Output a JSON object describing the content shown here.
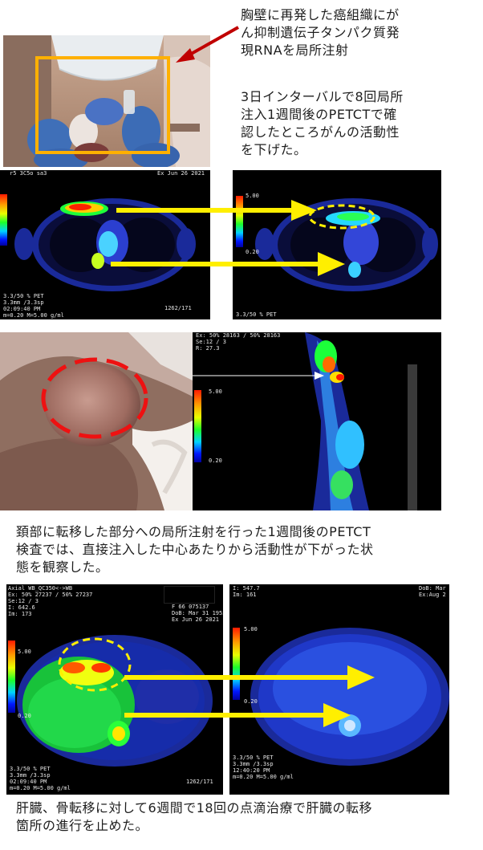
{
  "top_note": {
    "line1": "胸壁に再発した癌組織にが",
    "line2": "ん抑制遺伝子タンパク質発",
    "line3": "現RNAを局所注射"
  },
  "interval_note": {
    "line1": "3日インターバルで8回局所",
    "line2": "注入1週間後のPETCTで確",
    "line3": "認したところがんの活動性",
    "line4": "を下げた。"
  },
  "neck_note": {
    "line1": "頚部に転移した部分への局所注射を行った1週間後のPETCT",
    "line2": "検査では、直接注入した中心あたりから活動性が下がった状",
    "line3": "態を観察した。"
  },
  "liver_note": {
    "line1": "肝臓、骨転移に対して6週間で18回の点滴治療で肝臓の転移",
    "line2": "箇所の進行を止めた。"
  },
  "colorbar": {
    "max": "5.00",
    "min": "0.20"
  },
  "scan_chest_before": {
    "top_left": "r5 3C5o sa3",
    "top_right": "Ex Jun 26 2021",
    "bottom": [
      "3.3/50 % PET",
      "3.3mm /3.3sp",
      "02:09:40 PM",
      "m=0.20 M=5.00 g/ml"
    ],
    "bottom_right": "1262/171"
  },
  "scan_chest_after": {
    "bottom": [
      "3.3/50 % PET"
    ]
  },
  "scan_sagittal": {
    "lines": [
      "Ex: 50% 28163 / 50% 28163",
      "Se:12 / 3",
      "R: 27.3"
    ]
  },
  "scan_liver_before": {
    "lines": [
      "Axial WB_QC350<->WB",
      "Ex: 50% 27237 / 50% 27237",
      "Se:12 / 3",
      "I: 642.6",
      "Im: 173"
    ],
    "right_lines": [
      "F 66 075137",
      "DoB: Mar 31 1955",
      "Ex Jun 26 2021"
    ],
    "bottom": [
      "3.3/50 % PET",
      "3.3mm /3.3sp",
      "02:09:40 PM",
      "m=0.20 M=5.00 g/ml"
    ],
    "bottom_right": "1262/171"
  },
  "scan_liver_after": {
    "lines": [
      "I: 547.7",
      "Im: 161"
    ],
    "right_lines": [
      "DoB: Mar",
      "Ex:Aug 2"
    ],
    "bottom": [
      "3.3/50 % PET",
      "3.3mm /3.3sp",
      "12:40:20 PM",
      "m=0.20 M=5.00 g/ml"
    ]
  }
}
